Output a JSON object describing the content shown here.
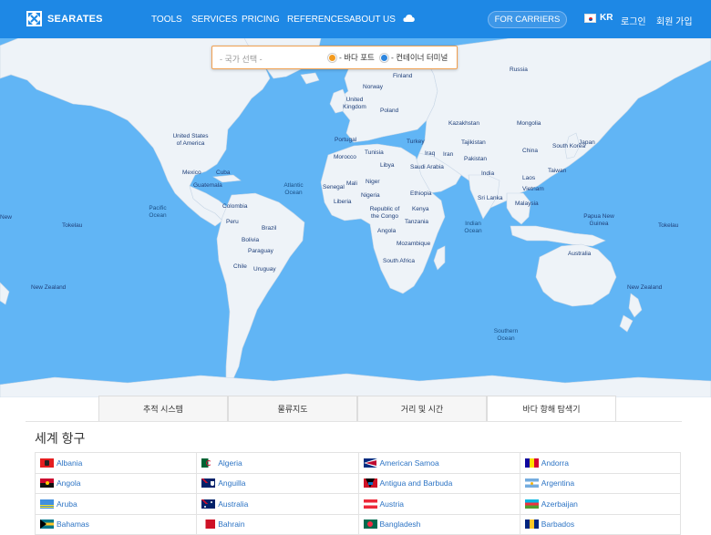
{
  "header": {
    "logo_text": "SEARATES",
    "nav": [
      "TOOLS",
      "SERVICES",
      "PRICING",
      "REFERENCES",
      "ABOUT US"
    ],
    "carriers_button": "FOR CARRIERS",
    "language_code": "KR",
    "login": "로그인",
    "signup": "회원 가입",
    "brand_color": "#1e88e5"
  },
  "map": {
    "search": {
      "country_placeholder": "- 국가 선택 -",
      "sea_port_label": "- 바다 포트",
      "container_terminal_label": "- 컨테이너 터미널",
      "sea_port_color": "#f39a1e",
      "container_terminal_color": "#2e86de"
    },
    "labels": {
      "russia": "Russia",
      "finland": "Finland",
      "norway": "Norway",
      "united_kingdom": "United Kingdom",
      "poland": "Poland",
      "kazakhstan": "Kazakhstan",
      "mongolia": "Mongolia",
      "portugal": "Portugal",
      "turkey": "Turkey",
      "tajikistan": "Tajikistan",
      "china": "China",
      "south_korea": "South Korea",
      "japan": "Japan",
      "united_states": "United States of America",
      "morocco": "Morocco",
      "tunisia": "Tunisia",
      "iraq": "Iraq",
      "iran": "Iran",
      "pakistan": "Pakistan",
      "libya": "Libya",
      "saudi_arabia": "Saudi Arabia",
      "taiwan": "Taiwan",
      "mexico": "Mexico",
      "cuba": "Cuba",
      "india": "India",
      "laos": "Laos",
      "guatemala": "Guatemala",
      "senegal": "Senegal",
      "mali": "Mali",
      "niger": "Niger",
      "vietnam": "Vietnam",
      "nigeria": "Nigeria",
      "ethiopia": "Ethiopia",
      "sri_lanka": "Sri Lanka",
      "liberia": "Liberia",
      "colombia": "Colombia",
      "malaysia": "Malaysia",
      "republic_congo": "Republic of the Congo",
      "kenya": "Kenya",
      "tanzania": "Tanzania",
      "papua_new_guinea": "Papua New Guinea",
      "new_left": "New",
      "tokelau_left": "Tokelau",
      "peru": "Peru",
      "brazil": "Brazil",
      "angola": "Angola",
      "tokelau_right": "Tokelau",
      "bolivia": "Bolivia",
      "mozambique": "Mozambique",
      "paraguay": "Paraguay",
      "australia": "Australia",
      "chile": "Chile",
      "south_africa": "South Africa",
      "uruguay": "Uruguay",
      "new_zealand_left": "New Zealand",
      "new_zealand_right": "New Zealand",
      "atlantic": "Atlantic Ocean",
      "pacific": "Pacific Ocean",
      "indian": "Indian Ocean",
      "southern": "Southern Ocean"
    }
  },
  "tabs": [
    {
      "label": "추적 시스템",
      "active": false
    },
    {
      "label": "물류지도",
      "active": false
    },
    {
      "label": "거리 및 시간",
      "active": false
    },
    {
      "label": "바다 항해 탐색기",
      "active": true
    }
  ],
  "ports_section": {
    "title": "세계 항구",
    "rows": [
      [
        {
          "country": "Albania",
          "flag": "albania"
        },
        {
          "country": "Algeria",
          "flag": "algeria"
        },
        {
          "country": "American Samoa",
          "flag": "american-samoa"
        },
        {
          "country": "Andorra",
          "flag": "andorra"
        }
      ],
      [
        {
          "country": "Angola",
          "flag": "angola"
        },
        {
          "country": "Anguilla",
          "flag": "anguilla"
        },
        {
          "country": "Antigua and Barbuda",
          "flag": "antigua"
        },
        {
          "country": "Argentina",
          "flag": "argentina"
        }
      ],
      [
        {
          "country": "Aruba",
          "flag": "aruba"
        },
        {
          "country": "Australia",
          "flag": "australia"
        },
        {
          "country": "Austria",
          "flag": "austria"
        },
        {
          "country": "Azerbaijan",
          "flag": "azerbaijan"
        }
      ],
      [
        {
          "country": "Bahamas",
          "flag": "bahamas"
        },
        {
          "country": "Bahrain",
          "flag": "bahrain"
        },
        {
          "country": "Bangladesh",
          "flag": "bangladesh"
        },
        {
          "country": "Barbados",
          "flag": "barbados"
        }
      ]
    ]
  }
}
